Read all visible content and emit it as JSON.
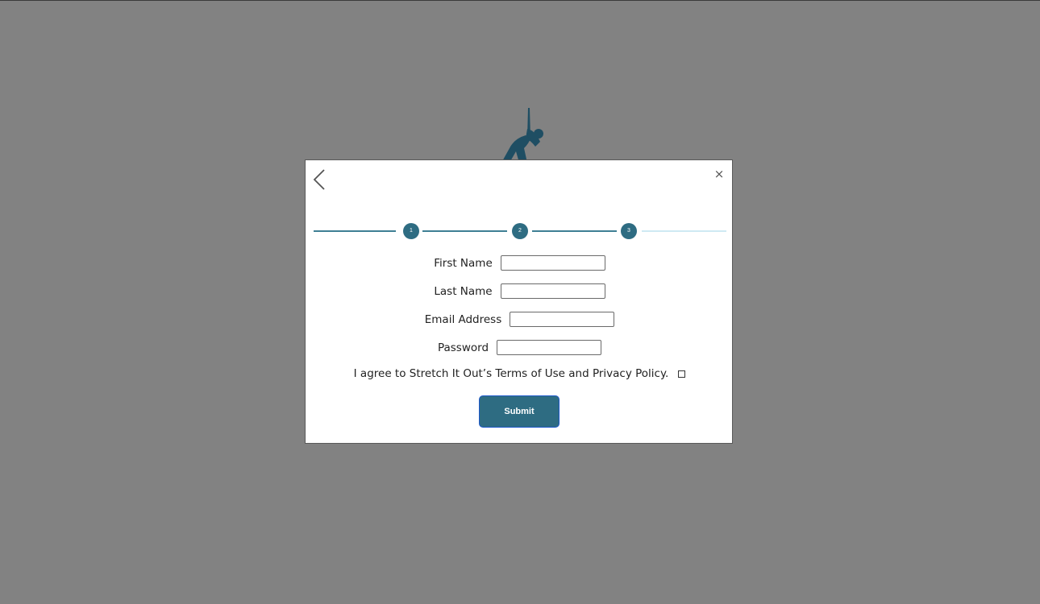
{
  "background": {
    "logo_icon": "stretching-person-icon",
    "overlay_color": "#828282",
    "brand_color": "#1f4e63"
  },
  "modal": {
    "back_icon": "chevron-left-icon",
    "close_label": "×",
    "stepper": {
      "steps": [
        "1",
        "2",
        "3"
      ],
      "current_step": 3,
      "active_color": "#2e6c82",
      "inactive_line_color": "#cfe9f3"
    },
    "form": {
      "first_name_label": "First Name",
      "first_name_value": "",
      "last_name_label": "Last Name",
      "last_name_value": "",
      "email_label": "Email Address",
      "email_value": "",
      "password_label": "Password",
      "password_value": "",
      "agree_text": "I agree to Stretch It Out’s Terms of Use and Privacy Policy.",
      "agree_checked": false
    },
    "submit_label": "Submit"
  }
}
